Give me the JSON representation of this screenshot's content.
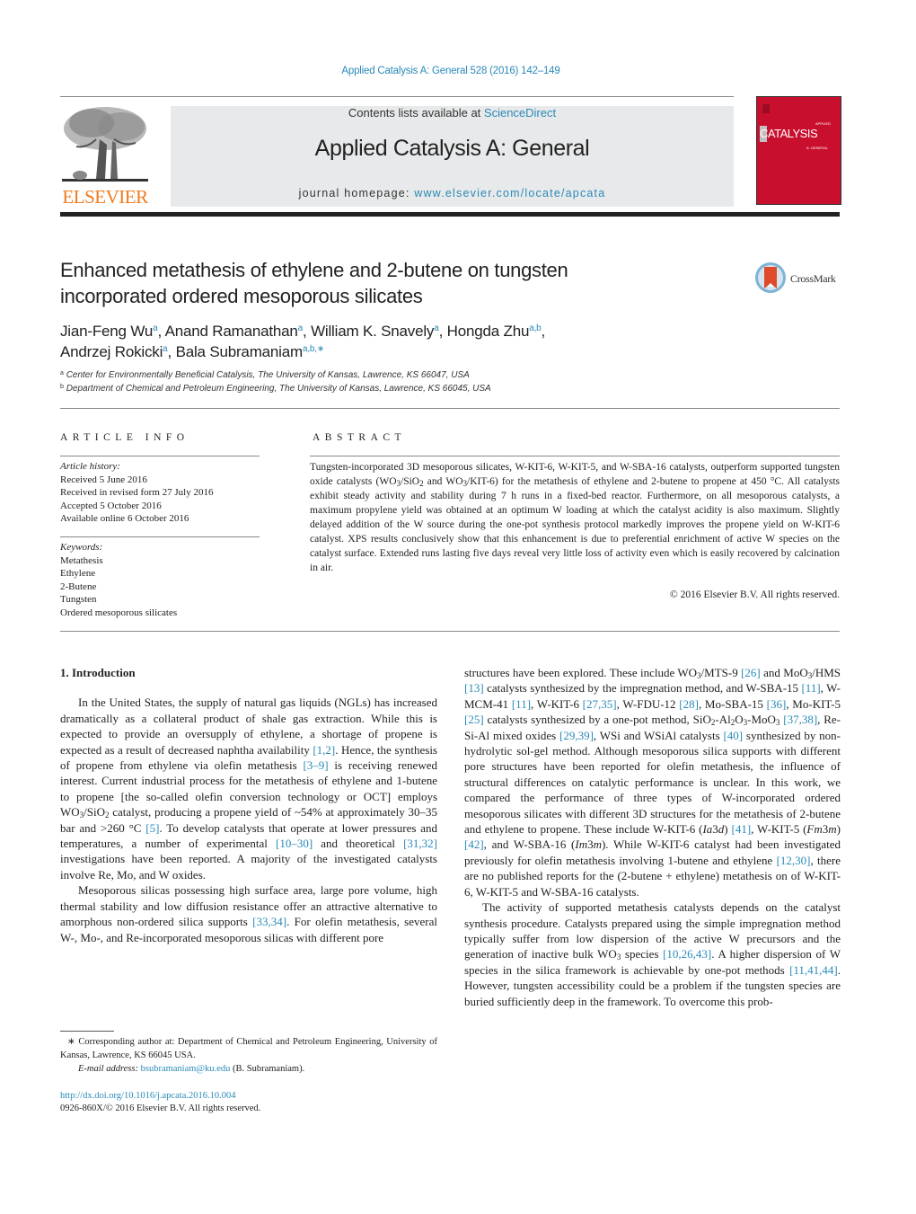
{
  "header": {
    "journal_ref": "Applied Catalysis A: General 528 (2016) 142–149",
    "contents_prefix": "Contents lists available at ",
    "contents_link": "ScienceDirect",
    "journal_title": "Applied Catalysis A: General",
    "homepage_prefix": "journal homepage: ",
    "homepage_link": "www.elsevier.com/locate/apcata",
    "publisher_logo": "ELSEVIER",
    "cover_title": "CATALYSIS",
    "cover_top": "APPLIED",
    "cover_sub": "A: GENERAL"
  },
  "colors": {
    "link": "#2a8ab8",
    "elsevier_orange": "#f07a1c",
    "cover_red": "#c8102e",
    "masthead_bg": "#e8e9ea"
  },
  "article": {
    "title_line1": "Enhanced metathesis of ethylene and 2-butene on tungsten",
    "title_line2": "incorporated ordered mesoporous silicates",
    "crossmark_label": "CrossMark",
    "authors": [
      {
        "name": "Jian-Feng Wu",
        "aff": "a"
      },
      {
        "name": "Anand Ramanathan",
        "aff": "a"
      },
      {
        "name": "William K. Snavely",
        "aff": "a"
      },
      {
        "name": "Hongda Zhu",
        "aff": "a,b"
      },
      {
        "name": "Andrzej Rokicki",
        "aff": "a"
      },
      {
        "name": "Bala Subramaniam",
        "aff": "a,b,∗"
      }
    ],
    "affiliations": [
      {
        "mark": "a",
        "text": "Center for Environmentally Beneficial Catalysis, The University of Kansas, Lawrence, KS 66047, USA"
      },
      {
        "mark": "b",
        "text": "Department of Chemical and Petroleum Engineering, The University of Kansas, Lawrence, KS 66045, USA"
      }
    ]
  },
  "article_info": {
    "heading": "ARTICLE INFO",
    "history_label": "Article history:",
    "history": [
      "Received 5 June 2016",
      "Received in revised form 27 July 2016",
      "Accepted 5 October 2016",
      "Available online 6 October 2016"
    ],
    "keywords_label": "Keywords:",
    "keywords": [
      "Metathesis",
      "Ethylene",
      "2-Butene",
      "Tungsten",
      "Ordered mesoporous silicates"
    ]
  },
  "abstract": {
    "heading": "ABSTRACT",
    "t1": "Tungsten-incorporated 3D mesoporous silicates, W-KIT-6, W-KIT-5, and W-SBA-16 catalysts, outperform supported tungsten oxide catalysts (WO",
    "t2": "/SiO",
    "t3": " and WO",
    "t4": "/KIT-6) for the metathesis of ethylene and 2-butene to propene at 450 °C. All catalysts exhibit steady activity and stability during 7 h runs in a fixed-bed reactor. Furthermore, on all mesoporous catalysts, a maximum propylene yield was obtained at an optimum W loading at which the catalyst acidity is also maximum. Slightly delayed addition of the W source during the one-pot synthesis protocol markedly improves the propene yield on W-KIT-6 catalyst. XPS results conclusively show that this enhancement is due to preferential enrichment of active W species on the catalyst surface. Extended runs lasting five days reveal very little loss of activity even which is easily recovered by calcination in air.",
    "sub3": "3",
    "sub2": "2",
    "copyright": "© 2016 Elsevier B.V. All rights reserved."
  },
  "body": {
    "section_heading": "1.  Introduction",
    "p1": {
      "a": "In the United States, the supply of natural gas liquids (NGLs) has increased dramatically as a collateral product of shale gas extraction. While this is expected to provide an oversupply of ethylene, a shortage of propene is expected as a result of decreased naphtha availability ",
      "c1": "[1,2]",
      "b": ". Hence, the synthesis of propene from ethylene via olefin metathesis ",
      "c2": "[3–9]",
      "c": " is receiving renewed interest. Current industrial process for the metathesis of ethylene and 1-butene to propene [the so-called olefin conversion technology or OCT] employs WO",
      "d": "/SiO",
      "e": " catalyst, producing a propene yield of ~54% at approximately 30–35 bar and >260 °C ",
      "c3": "[5]",
      "f": ". To develop catalysts that operate at lower pressures and temperatures, a number of experimental ",
      "c4": "[10–30]",
      "g": " and theoretical ",
      "c5": "[31,32]",
      "h": " investigations have been reported. A majority of the investigated catalysts involve Re, Mo, and W oxides."
    },
    "p2": {
      "a": "Mesoporous silicas possessing high surface area, large pore volume, high thermal stability and low diffusion resistance offer an attractive alternative to amorphous non-ordered silica supports ",
      "c1": "[33,34]",
      "b": ". For olefin metathesis, several W-, Mo-, and Re-incorporated mesoporous silicas with different pore structures have been explored. These include WO",
      "c": "/MTS-9 ",
      "c2": "[26]",
      "d": " and MoO",
      "e": "/HMS ",
      "c3": "[13]",
      "f": " catalysts synthesized by the impregnation method, and W-SBA-15 ",
      "c4": "[11]",
      "g": ", W-MCM-41 ",
      "c5": "[11]",
      "h": ", W-KIT-6 ",
      "c6": "[27,35]",
      "i": ", W-FDU-12 ",
      "c7": "[28]",
      "j": ", Mo-SBA-15 ",
      "c8": "[36]",
      "k": ", Mo-KIT-5 ",
      "c9": "[25]",
      "l": " catalysts synthesized by a one-pot method, SiO",
      "m": "-Al",
      "n": "O",
      "o": "-MoO",
      "p": " ",
      "c10": "[37,38]",
      "q": ", Re-Si-Al mixed oxides ",
      "c11": "[29,39]",
      "r": ", WSi and WSiAl catalysts ",
      "c12": "[40]",
      "s": " synthesized by non-hydrolytic sol-gel method. Although mesoporous silica supports with different pore structures have been reported for olefin metathesis, the influence of structural differences on catalytic performance is unclear. In this work, we compared the performance of three types of W-incorporated ordered mesoporous silicates with different 3D structures for the metathesis of 2-butene and ethylene to propene. These include W-KIT-6 (",
      "i1": "Ia",
      "t": "3",
      "i2": "d",
      "u": ") ",
      "c13": "[41]",
      "v": ", W-KIT-5 (",
      "i3": "Fm",
      "w": "3",
      "i4": "m",
      "x": ") ",
      "c14": "[42]",
      "y": ", and W-SBA-16 (",
      "i5": "Im",
      "z": "3",
      "i6": "m",
      "aa": "). While W-KIT-6 catalyst had been investigated previously for olefin metathesis involving 1-butene and ethylene ",
      "c15": "[12,30]",
      "ab": ", there are no published reports for the (2-butene + ethylene) metathesis on of W-KIT-6, W-KIT-5 and W-SBA-16 catalysts."
    },
    "p3": {
      "a": "The activity of supported metathesis catalysts depends on the catalyst synthesis procedure. Catalysts prepared using the simple impregnation method typically suffer from low dispersion of the active W precursors and the generation of inactive bulk WO",
      "b": " species ",
      "c1": "[10,26,43]",
      "c": ". A higher dispersion of W species in the silica framework is achievable by one-pot methods ",
      "c2": "[11,41,44]",
      "d": ". However, tungsten accessibility could be a problem if the tungsten species are buried sufficiently deep in the framework. To overcome this prob-"
    },
    "sub2": "2",
    "sub3": "3"
  },
  "footnote": {
    "corresponding": "∗  Corresponding author at: Department of Chemical and Petroleum Engineering, University of Kansas, Lawrence, KS 66045 USA.",
    "email_label": "E-mail address: ",
    "email": "bsubramaniam@ku.edu",
    "email_name": " (B. Subramaniam).",
    "doi": "http://dx.doi.org/10.1016/j.apcata.2016.10.004",
    "issn": "0926-860X/© 2016 Elsevier B.V. All rights reserved."
  }
}
